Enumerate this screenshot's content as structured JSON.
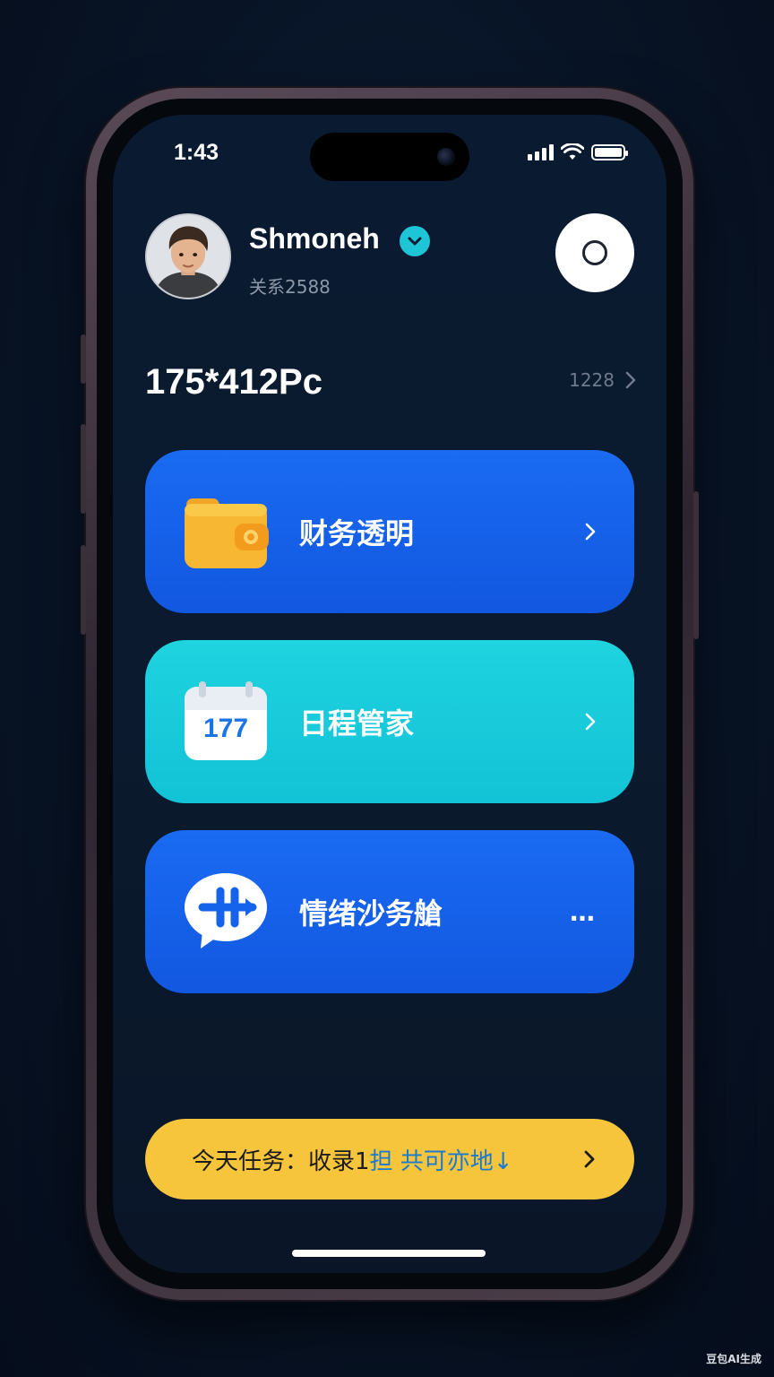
{
  "status_bar": {
    "time": "1:43",
    "icons": [
      "signal-icon",
      "wifi-icon",
      "battery-icon"
    ]
  },
  "profile": {
    "name": "Shmoneh",
    "subtitle": "关系2588",
    "verified_icon": "check-badge-icon",
    "action_icon": "ring-icon"
  },
  "balance": {
    "value": "175*412Pc",
    "link_text": "1228"
  },
  "cards": [
    {
      "label": "财务透明",
      "icon": "wallet-icon",
      "trailing": "chevron-right-icon",
      "color": "#1762EA"
    },
    {
      "label": "日程管家",
      "icon": "calendar-icon",
      "icon_number": "177",
      "trailing": "chevron-right-icon",
      "color": "#16CBDA"
    },
    {
      "label": "情绪沙务艙",
      "icon": "chat-bubble-icon",
      "trailing": "…",
      "color": "#1762EA"
    }
  ],
  "task": {
    "prefix": "今天任务：收录1",
    "highlight": "担 共可亦地↓",
    "trailing": "chevron-right-icon",
    "color": "#F7C53C"
  },
  "watermark": "豆包AI生成"
}
